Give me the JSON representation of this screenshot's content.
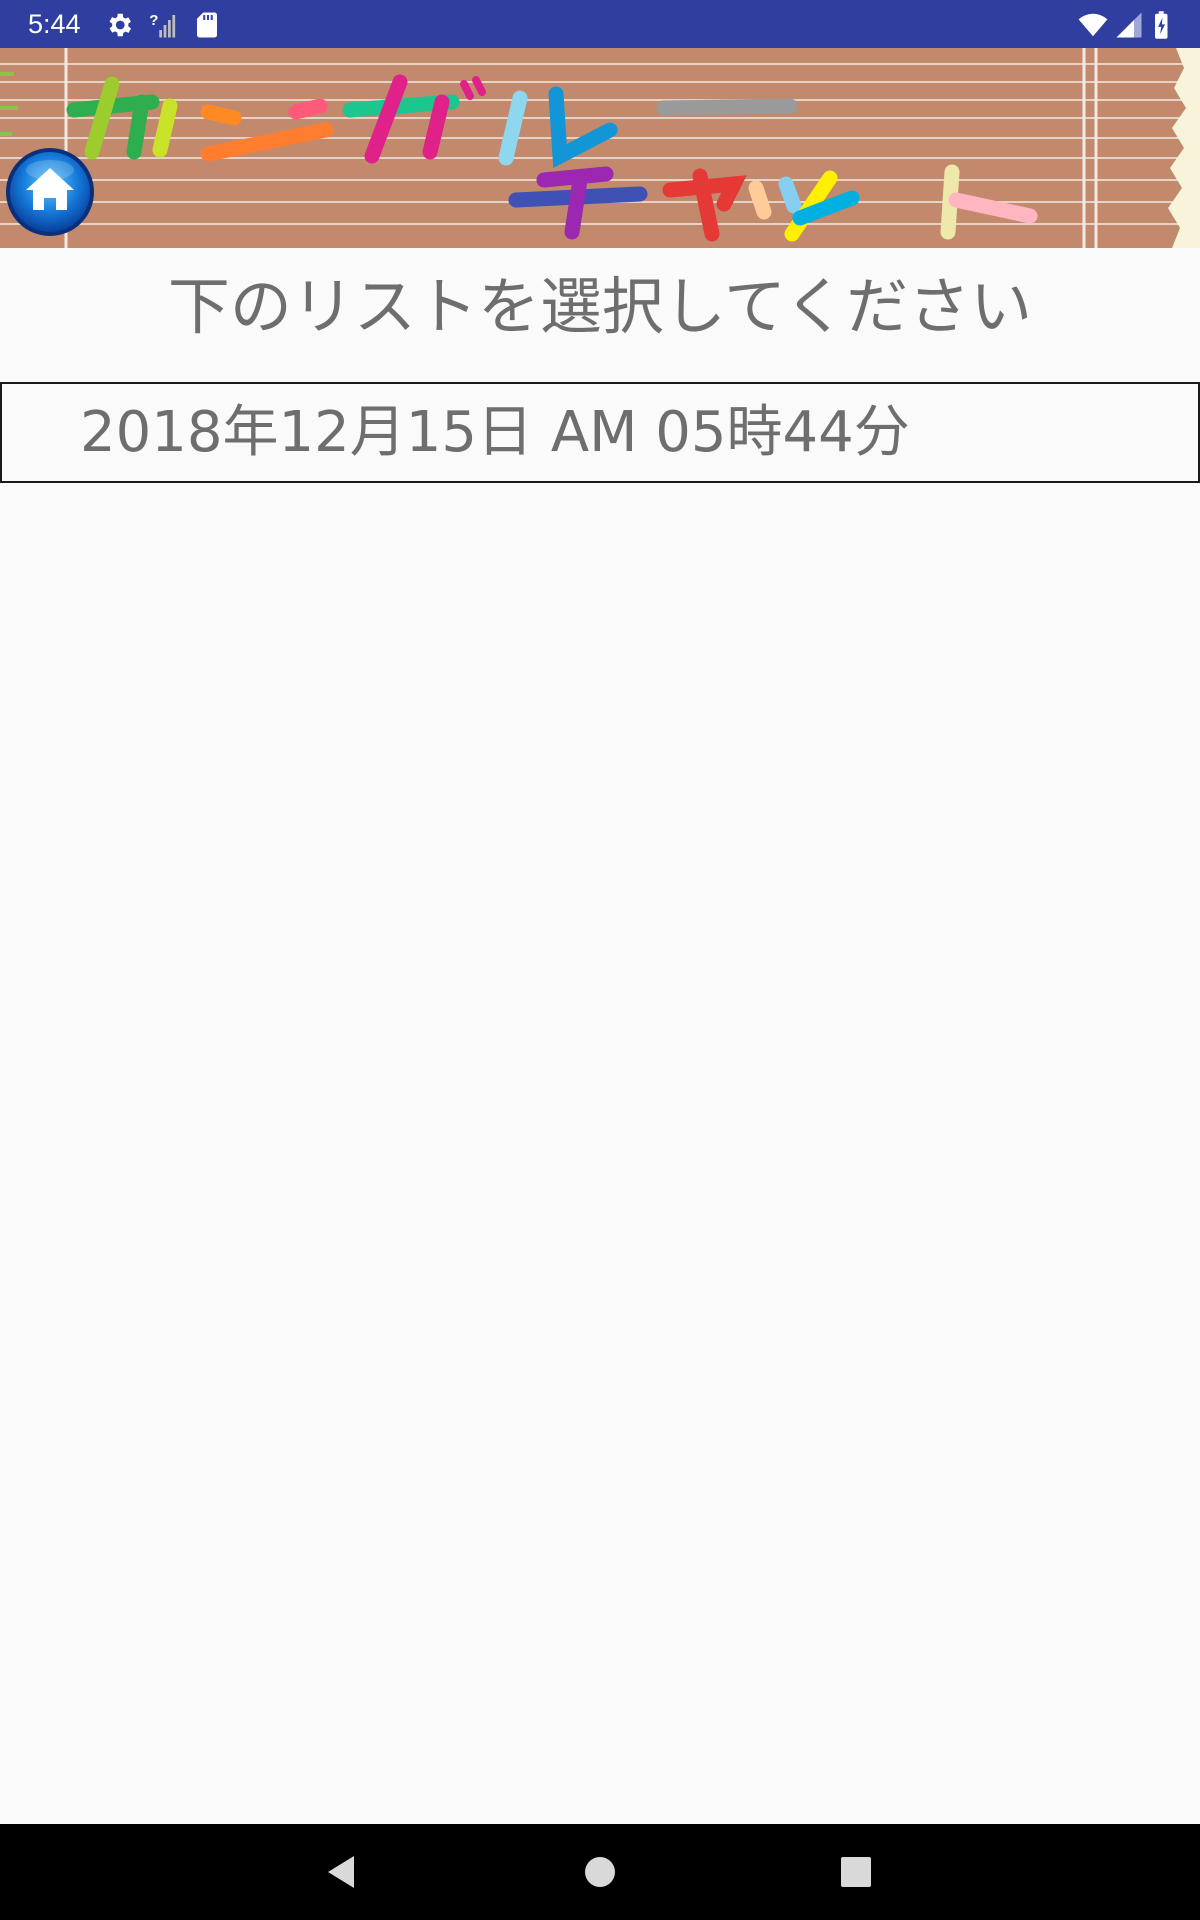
{
  "status_bar": {
    "time": "5:44",
    "icons": [
      "settings-icon",
      "no-sim-signal-icon",
      "sd-card-icon",
      "wifi-icon",
      "cell-signal-icon",
      "battery-charging-icon"
    ]
  },
  "header": {
    "title_line1": "カンガルー",
    "title_line2": "チャット",
    "home_icon": "home-icon"
  },
  "main": {
    "instruction": "下のリストを選択してください",
    "list_items": [
      {
        "label": "2018年12月15日 AM 05時44分"
      }
    ]
  },
  "navigation": {
    "back_icon": "back-triangle-icon",
    "home_icon": "home-circle-icon",
    "recents_icon": "recents-square-icon"
  },
  "colors": {
    "status_bar": "#303f9f",
    "banner_wood": "#c2896d",
    "text_gray": "#6e6e6e",
    "background": "#fafafa"
  }
}
